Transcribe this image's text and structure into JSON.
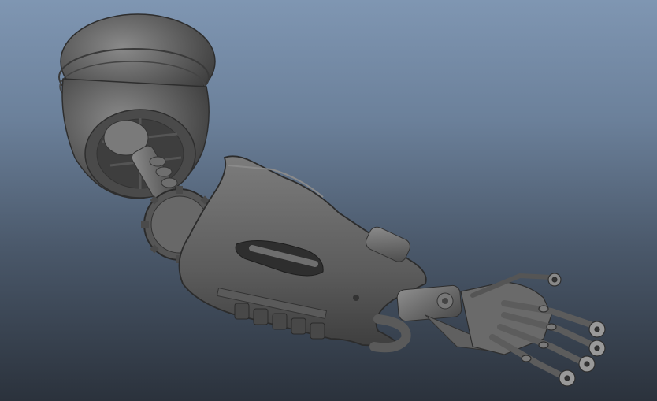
{
  "viewport": {
    "background_top": "#7f96b2",
    "background_bottom": "#2b323c",
    "model_color": "#6a6a6a",
    "model_shadow": "#3c3c3c",
    "model_highlight": "#9a9a9a",
    "model": "mechanical-arm"
  }
}
